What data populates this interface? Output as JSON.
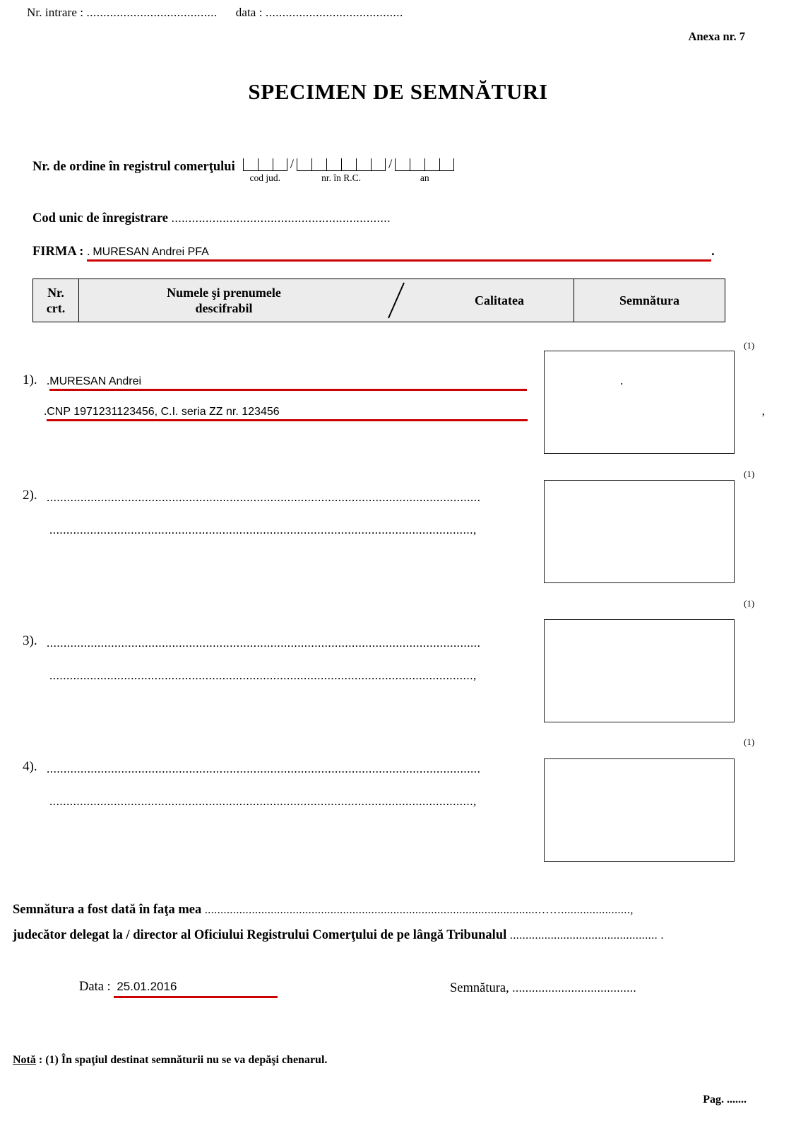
{
  "header": {
    "entry_no_label": "Nr. intrare : ",
    "entry_no_dots": ".......................................",
    "date_label": "data : ",
    "date_dots": ".........................................",
    "annex": "Anexa nr. 7"
  },
  "title": "SPECIMEN DE SEMNĂTURI",
  "registry": {
    "label": "Nr. de ordine în registrul comerţului",
    "separator": "/",
    "groups": [
      {
        "cells": 3,
        "label": "cod jud."
      },
      {
        "cells": 6,
        "label": "nr. în R.C."
      },
      {
        "cells": 4,
        "label": "an"
      }
    ]
  },
  "cui": {
    "label": "Cod unic de înregistrare ",
    "dots": "................................................................"
  },
  "firma": {
    "label": "FIRMA : ",
    "lead_dot": ".",
    "value": "MURESAN Andrei PFA",
    "tail": ".",
    "underline_color": "#cc0000"
  },
  "table": {
    "col_nr": "Nr.\ncrt.",
    "col_nr_line1": "Nr.",
    "col_nr_line2": "crt.",
    "col_name_line1": "Numele şi prenumele",
    "col_name_line2": "descifrabil",
    "col_calitatea": "Calitatea",
    "col_semnatura": "Semnătura",
    "header_bg": "#ececec"
  },
  "rows": [
    {
      "index": "1).",
      "filled": true,
      "lead_dot": ".",
      "line1_value": "MURESAN Andrei",
      "line1_tail": ".",
      "line2_lead_dot": ".",
      "line2_value": "CNP 1971231123456, C.I. seria ZZ nr. 123456",
      "line2_tail": ",",
      "note": "(1)"
    },
    {
      "index": "2).",
      "filled": false,
      "line1_dots": "................................................................................................................................",
      "line2_dots": ".............................................................................................................................,",
      "note": "(1)"
    },
    {
      "index": "3).",
      "filled": false,
      "line1_dots": "................................................................................................................................",
      "line2_dots": ".............................................................................................................................,",
      "note": "(1)"
    },
    {
      "index": "4).",
      "filled": false,
      "line1_dots": "................................................................................................................................",
      "line2_dots": ".............................................................................................................................,",
      "note": "(1)"
    }
  ],
  "statements": {
    "line1_label": "Semnătura a fost dată în faţa mea ",
    "line1_dots": "..........................................................................................................……......................,",
    "line2_label": "judecător delegat  la  / director al Oficiului Registrului Comerţului de pe lângă Tribunalul ",
    "line2_dots": "............................................... ."
  },
  "footer": {
    "data_label": "Data : ",
    "data_value": "25.01.2016",
    "semnatura_label": "Semnătura, ",
    "semnatura_dots": "......................................",
    "nota_label": "Notă",
    "nota_text": " : (1) În spaţiul destinat semnăturii nu se va depăşi chenarul.",
    "page_label": "Pag. ......."
  }
}
